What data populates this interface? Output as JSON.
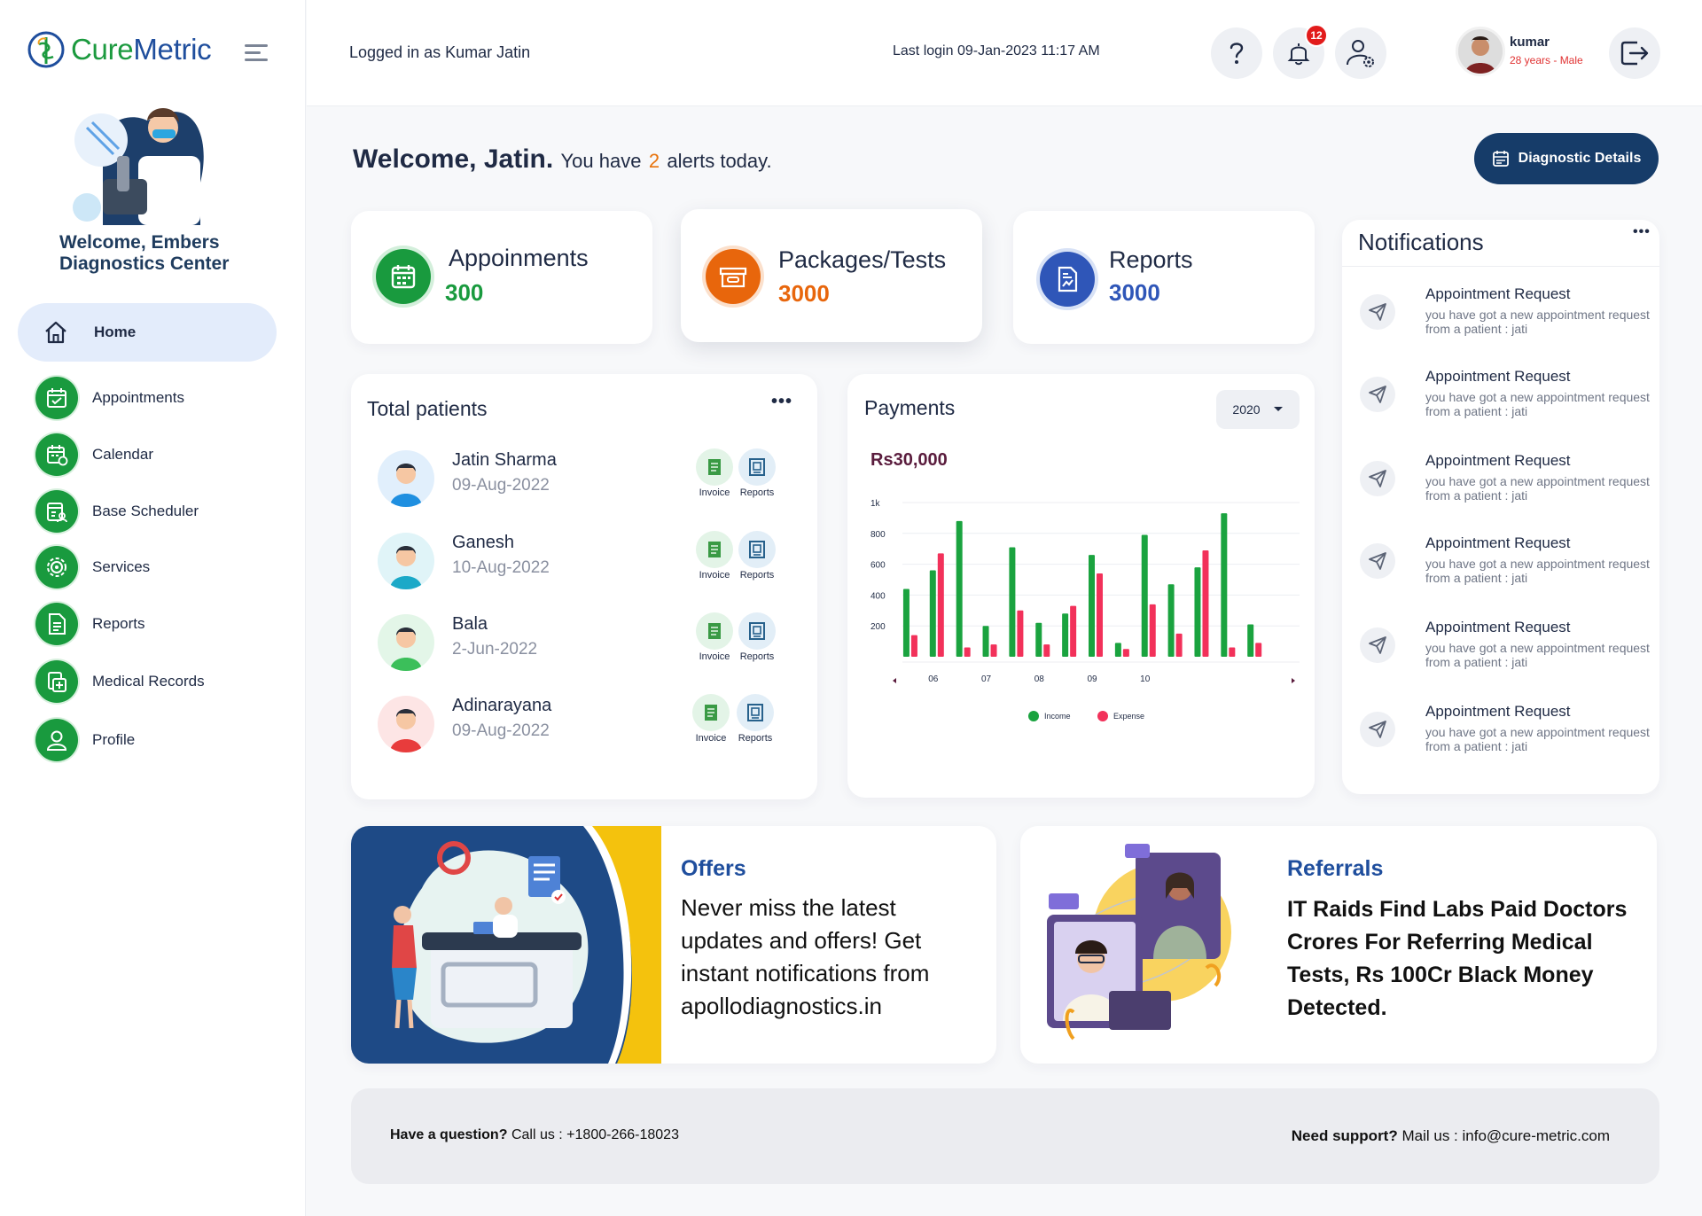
{
  "app": {
    "brand_part1": "Cure",
    "brand_part2": "Metric"
  },
  "sidebar": {
    "welcome": "Welcome, Embers Diagnostics Center",
    "home_label": "Home",
    "items": [
      {
        "label": "Appointments",
        "icon": "calendar-check-icon"
      },
      {
        "label": "Calendar",
        "icon": "calendar-icon"
      },
      {
        "label": "Base Scheduler",
        "icon": "scheduler-icon"
      },
      {
        "label": "Services",
        "icon": "gear-icon"
      },
      {
        "label": "Reports",
        "icon": "document-icon"
      },
      {
        "label": "Medical Records",
        "icon": "medical-records-icon"
      },
      {
        "label": "Profile",
        "icon": "user-icon"
      }
    ]
  },
  "topbar": {
    "logged_in": "Logged in as Kumar Jatin",
    "last_login": "Last login 09-Jan-2023 11:17 AM",
    "notification_count": "12",
    "user_name": "kumar",
    "user_meta": "28 years - Male"
  },
  "welcome": {
    "greeting": "Welcome, Jatin.",
    "sub_prefix": "You have",
    "alert_count": "2",
    "sub_suffix": "alerts today.",
    "diagnostic_button": "Diagnostic Details"
  },
  "stats": [
    {
      "title": "Appoinments",
      "value": "300",
      "color": "#199a3e"
    },
    {
      "title": "Packages/Tests",
      "value": "3000",
      "color": "#e8660c"
    },
    {
      "title": "Reports",
      "value": "3000",
      "color": "#2f56b8"
    }
  ],
  "patients": {
    "title": "Total patients",
    "invoice_label": "Invoice",
    "reports_label": "Reports",
    "rows": [
      {
        "name": "Jatin Sharma",
        "date": "09-Aug-2022",
        "color": "#1f8fe0"
      },
      {
        "name": "Ganesh",
        "date": "10-Aug-2022",
        "color": "#1ba9c8"
      },
      {
        "name": "Bala",
        "date": "2-Jun-2022",
        "color": "#3bbf5a"
      },
      {
        "name": "Adinarayana",
        "date": "09-Aug-2022",
        "color": "#e83c3c"
      }
    ]
  },
  "payments": {
    "title": "Payments",
    "year": "2020",
    "total": "Rs30,000"
  },
  "chart_data": {
    "type": "bar",
    "categories": [
      "",
      "06",
      "",
      "07",
      "",
      "08",
      "",
      "09",
      "",
      "10",
      "",
      "",
      "",
      "",
      ""
    ],
    "series": [
      {
        "name": "Income",
        "color": "#1aa33f",
        "values": [
          440,
          560,
          880,
          200,
          710,
          220,
          280,
          660,
          90,
          790,
          470,
          580,
          930,
          210,
          0
        ]
      },
      {
        "name": "Expense",
        "color": "#f2315a",
        "values": [
          140,
          670,
          60,
          80,
          300,
          80,
          330,
          540,
          50,
          340,
          150,
          690,
          60,
          90,
          0
        ]
      }
    ],
    "y_ticks": [
      "200",
      "400",
      "600",
      "800",
      "1k"
    ],
    "ylim": [
      0,
      1000
    ],
    "legend_position": "bottom",
    "grid": true
  },
  "notifications": {
    "title": "Notifications",
    "items": [
      {
        "title": "Appointment Request",
        "text": "you have got a new appointment request from a patient : jati"
      },
      {
        "title": "Appointment Request",
        "text": "you have got a new appointment request from a patient : jati"
      },
      {
        "title": "Appointment Request",
        "text": "you have got a new appointment request from a patient : jati"
      },
      {
        "title": "Appointment Request",
        "text": "you have got a new appointment request from a patient : jati"
      },
      {
        "title": "Appointment Request",
        "text": "you have got a new appointment request from a patient : jati"
      },
      {
        "title": "Appointment Request",
        "text": "you have got a new appointment request from a patient : jati"
      }
    ]
  },
  "offers": {
    "heading": "Offers",
    "text": "Never miss the latest updates and offers! Get instant notifications from apollodiagnostics.in"
  },
  "referrals": {
    "heading": "Referrals",
    "text": "IT Raids Find Labs Paid Doctors Crores For Referring Medical Tests, Rs 100Cr Black Money Detected."
  },
  "footer": {
    "question_bold": "Have a question?",
    "question_text": "Call us : +1800-266-18023",
    "support_bold": "Need support?",
    "support_text": "Mail us : info@cure-metric.com"
  }
}
